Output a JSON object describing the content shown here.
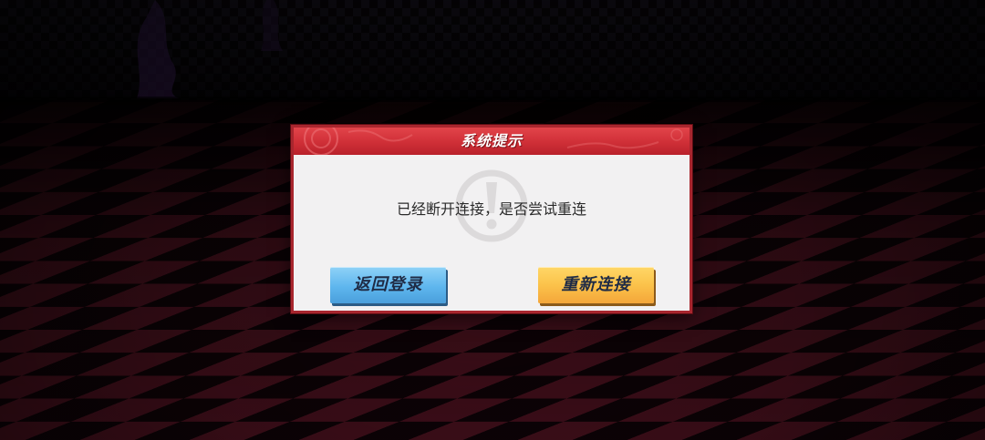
{
  "dialog": {
    "title": "系统提示",
    "message": "已经断开连接，是否尝试重连"
  },
  "buttons": {
    "back_label": "返回登录",
    "reconnect_label": "重新连接"
  },
  "icons": {
    "watermark": "exclamation-circle-icon",
    "header_decoration": "swirl-emblem-icon"
  },
  "colors": {
    "header_red": "#cf2f37",
    "border_red": "#a8262e",
    "dialog_bg": "#f2f1f2",
    "button_blue": "#5eb6ee",
    "button_yellow": "#fbc24a",
    "floor_red": "#5a1525",
    "floor_dark": "#120409"
  }
}
